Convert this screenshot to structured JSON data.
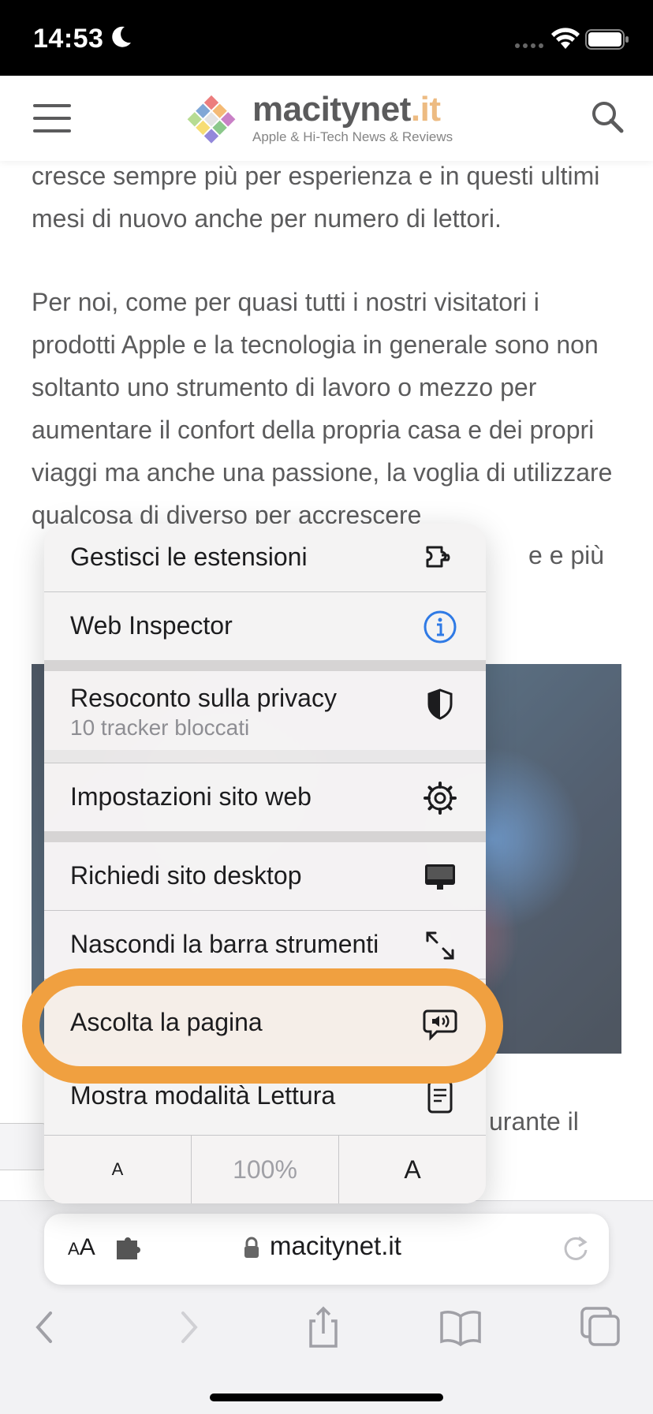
{
  "status_bar": {
    "time": "14:53",
    "icons": [
      "moon-icon",
      "signal-dots-icon",
      "wifi-icon",
      "battery-icon"
    ]
  },
  "site_header": {
    "logo_name": "macitynet",
    "logo_tld": ".it",
    "tagline": "Apple & Hi-Tech News & Reviews",
    "brand_color": "#e7a153"
  },
  "article": {
    "paragraph1": "cresce sempre più per esperienza e in questi ultimi mesi di nuovo anche per numero di lettori.",
    "paragraph2": "Per noi, come per quasi tutti i nostri visitatori i prodotti Apple e la tecnologia in generale sono non soltanto uno strumento di lavoro o mezzo per aumentare il confort della propria casa e dei propri viaggi ma anche una passione, la voglia di utilizzare qualcosa di diverso per accrescere",
    "fragment_right": "e e più",
    "after_photo": "urante il"
  },
  "menu": {
    "items": [
      {
        "label": "Gestisci le estensioni",
        "icon": "extensions-icon"
      },
      {
        "label": "Web Inspector",
        "icon": "info-icon"
      },
      {
        "label": "Resoconto sulla privacy",
        "sublabel": "10 tracker bloccati",
        "icon": "privacy-shield-icon"
      },
      {
        "label": "Impostazioni sito web",
        "icon": "gear-icon"
      },
      {
        "label": "Richiedi sito desktop",
        "icon": "desktop-icon"
      },
      {
        "label": "Nascondi la barra strumenti",
        "icon": "expand-arrows-icon"
      },
      {
        "label": "Ascolta la pagina",
        "icon": "speech-bubble-icon"
      },
      {
        "label": "Mostra modalità Lettura",
        "icon": "reader-icon"
      }
    ],
    "font_size": {
      "smaller": "A",
      "zoom": "100%",
      "larger": "A"
    },
    "highlight_color": "#f0a040"
  },
  "toolbar": {
    "aa_label_small": "A",
    "aa_label": "A",
    "host": "macitynet.it",
    "icons": [
      "back-icon",
      "forward-icon",
      "share-icon",
      "bookmarks-icon",
      "tabs-icon"
    ]
  }
}
